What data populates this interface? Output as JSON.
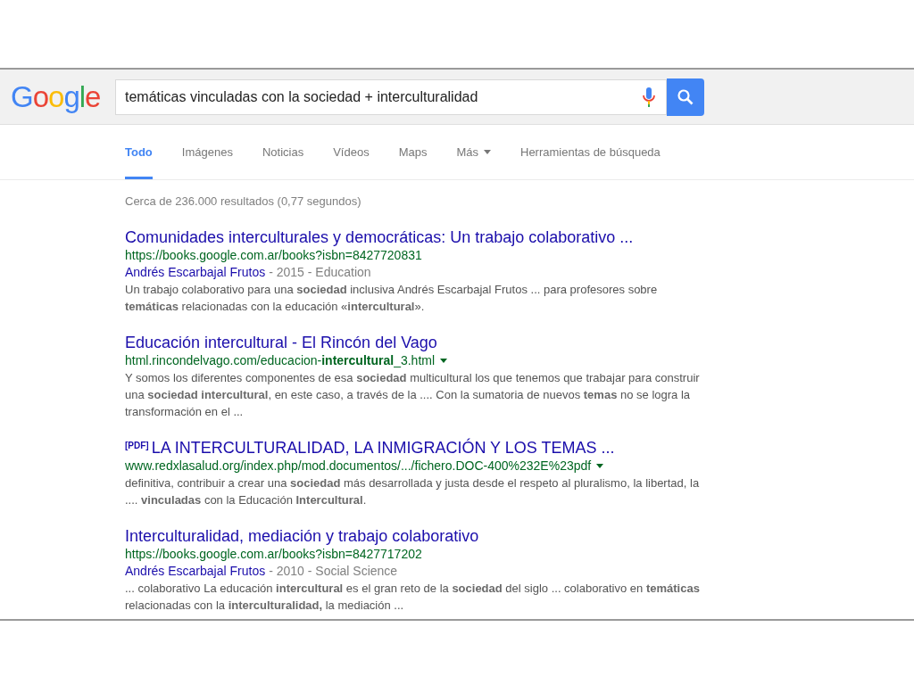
{
  "logo": "Google",
  "search": {
    "value": "temáticas vinculadas con la sociedad + interculturalidad"
  },
  "tabs": [
    {
      "label": "Todo",
      "selected": true,
      "has_menu": false
    },
    {
      "label": "Imágenes",
      "selected": false,
      "has_menu": false
    },
    {
      "label": "Noticias",
      "selected": false,
      "has_menu": false
    },
    {
      "label": "Vídeos",
      "selected": false,
      "has_menu": false
    },
    {
      "label": "Maps",
      "selected": false,
      "has_menu": false
    },
    {
      "label": "Más",
      "selected": false,
      "has_menu": true
    },
    {
      "label": "Herramientas de búsqueda",
      "selected": false,
      "has_menu": false
    }
  ],
  "result_stats": "Cerca de 236.000 resultados (0,77 segundos)",
  "results": [
    {
      "title": "Comunidades interculturales y democráticas: Un trabajo colaborativo ...",
      "url": "https://books.google.com.ar/books?isbn=8427720831",
      "has_menu": false,
      "meta": {
        "author": "Andrés Escarbajal Frutos",
        "rest": "- 2015 - Education"
      },
      "snippet": "Un trabajo colaborativo para una **sociedad** inclusiva Andrés Escarbajal Frutos ... para profesores sobre **temáticas** relacionadas con la educación «**intercultural**»."
    },
    {
      "title": "Educación intercultural - El Rincón del Vago",
      "url": "html.rincondelvago.com/educacion-**intercultural**_3.html",
      "has_menu": true,
      "snippet": "Y somos los diferentes componentes de esa **sociedad** multicultural los que tenemos que trabajar para construir una **sociedad intercultural**, en este caso, a través de la .... Con la sumatoria de nuevos **temas** no se logra la transformación en el ..."
    },
    {
      "tag": "[PDF]",
      "title": "LA INTERCULTURALIDAD, LA INMIGRACIÓN Y LOS TEMAS ...",
      "url": "www.redxlasalud.org/index.php/mod.documentos/.../fichero.DOC-400%232E%23pdf",
      "has_menu": true,
      "snippet": "definitiva, contribuir a crear una **sociedad** más desarrollada y justa desde el respeto al pluralismo, la libertad, la .... **vinculadas** con la Educación **Intercultural**."
    },
    {
      "title": "Interculturalidad, mediación y trabajo colaborativo",
      "url": "https://books.google.com.ar/books?isbn=8427717202",
      "has_menu": false,
      "meta": {
        "author": "Andrés Escarbajal Frutos",
        "rest": "- 2010 - Social Science"
      },
      "snippet": "... colaborativo La educación **intercultural** es el gran reto de la **sociedad** del siglo ... colaborativo en **temáticas** relacionadas con la **interculturalidad,** la mediación ..."
    }
  ]
}
